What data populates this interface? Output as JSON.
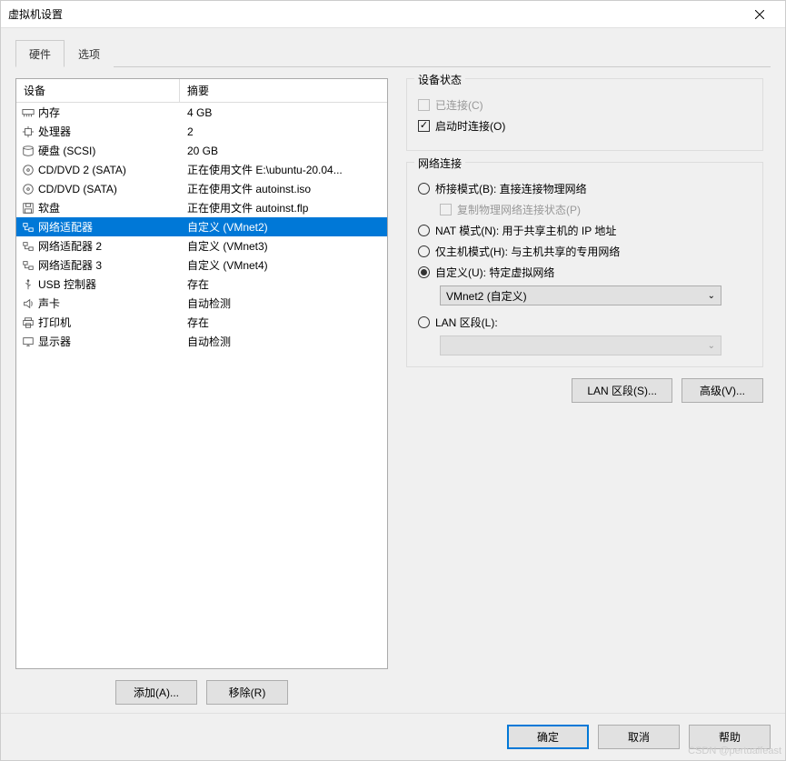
{
  "title": "虚拟机设置",
  "tabs": {
    "hardware": "硬件",
    "options": "选项"
  },
  "columns": {
    "device": "设备",
    "summary": "摘要"
  },
  "devices": [
    {
      "icon": "memory",
      "name": "内存",
      "summary": "4 GB"
    },
    {
      "icon": "cpu",
      "name": "处理器",
      "summary": "2"
    },
    {
      "icon": "hdd",
      "name": "硬盘 (SCSI)",
      "summary": "20 GB"
    },
    {
      "icon": "cd",
      "name": "CD/DVD 2 (SATA)",
      "summary": "正在使用文件 E:\\ubuntu-20.04..."
    },
    {
      "icon": "cd",
      "name": "CD/DVD (SATA)",
      "summary": "正在使用文件 autoinst.iso"
    },
    {
      "icon": "floppy",
      "name": "软盘",
      "summary": "正在使用文件 autoinst.flp"
    },
    {
      "icon": "net",
      "name": "网络适配器",
      "summary": "自定义 (VMnet2)",
      "selected": true
    },
    {
      "icon": "net",
      "name": "网络适配器 2",
      "summary": "自定义 (VMnet3)"
    },
    {
      "icon": "net",
      "name": "网络适配器 3",
      "summary": "自定义 (VMnet4)"
    },
    {
      "icon": "usb",
      "name": "USB 控制器",
      "summary": "存在"
    },
    {
      "icon": "sound",
      "name": "声卡",
      "summary": "自动检测"
    },
    {
      "icon": "printer",
      "name": "打印机",
      "summary": "存在"
    },
    {
      "icon": "display",
      "name": "显示器",
      "summary": "自动检测"
    }
  ],
  "buttons": {
    "add": "添加(A)...",
    "remove": "移除(R)",
    "lan": "LAN 区段(S)...",
    "advanced": "高级(V)...",
    "ok": "确定",
    "cancel": "取消",
    "help": "帮助"
  },
  "deviceStatus": {
    "legend": "设备状态",
    "connected": "已连接(C)",
    "connectOnPower": "启动时连接(O)"
  },
  "netConn": {
    "legend": "网络连接",
    "bridged": "桥接模式(B): 直接连接物理网络",
    "replicate": "复制物理网络连接状态(P)",
    "nat": "NAT 模式(N): 用于共享主机的 IP 地址",
    "hostonly": "仅主机模式(H): 与主机共享的专用网络",
    "custom": "自定义(U): 特定虚拟网络",
    "customValue": "VMnet2 (自定义)",
    "lan": "LAN 区段(L):"
  },
  "watermark": "CSDN @pertualfeast"
}
